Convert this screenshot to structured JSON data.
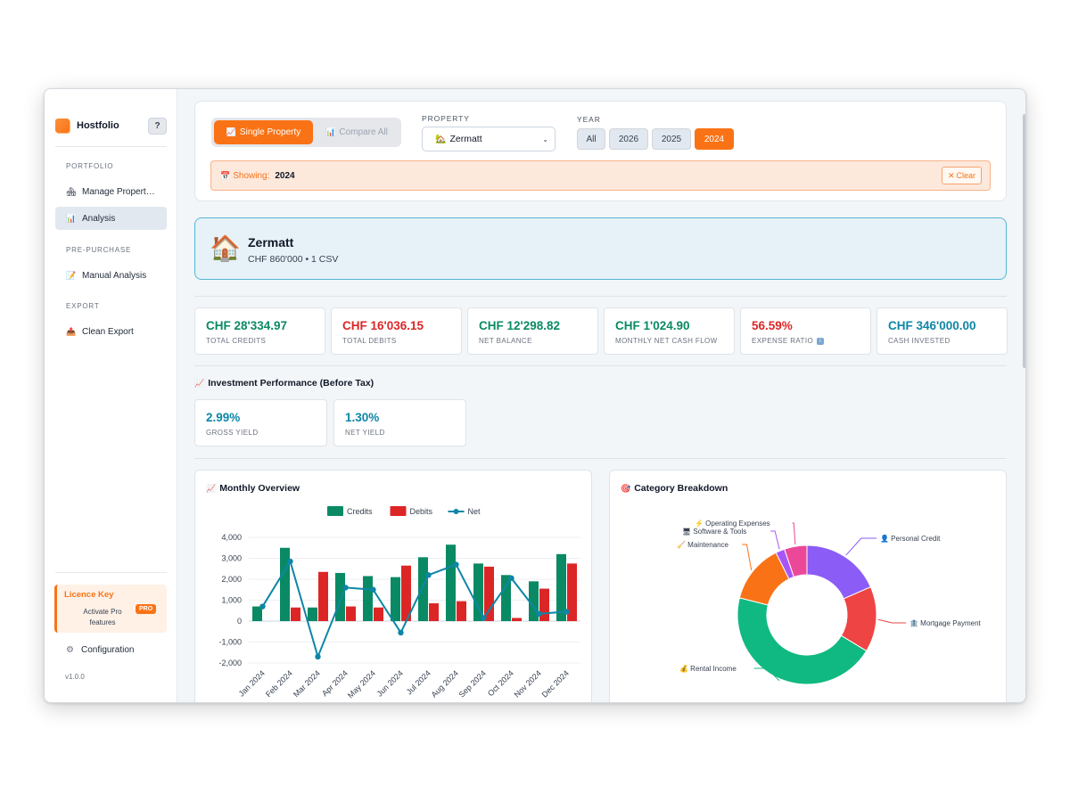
{
  "app": {
    "name": "Hostfolio",
    "help": "?"
  },
  "sidebar": {
    "sections": [
      {
        "label": "PORTFOLIO",
        "items": [
          {
            "label": "Manage Propert…",
            "icon": "house-icon"
          },
          {
            "label": "Analysis",
            "icon": "bar-chart-icon",
            "active": true
          }
        ]
      },
      {
        "label": "PRE-PURCHASE",
        "items": [
          {
            "label": "Manual Analysis",
            "icon": "memo-icon"
          }
        ]
      },
      {
        "label": "EXPORT",
        "items": [
          {
            "label": "Clean Export",
            "icon": "export-icon"
          }
        ]
      }
    ],
    "licence": {
      "title": "Licence Key",
      "desc": "Activate Pro features",
      "badge": "PRO"
    },
    "config_label": "Configuration",
    "version": "v1.0.0"
  },
  "toolbar": {
    "mode_single": "Single Property",
    "mode_compare": "Compare All",
    "property_label": "PROPERTY",
    "property_value": "Zermatt",
    "year_label": "YEAR",
    "years": [
      "All",
      "2026",
      "2025",
      "2024"
    ],
    "selected_year": "2024",
    "showing_label": "Showing:",
    "showing_value": "2024",
    "clear_label": "Clear"
  },
  "property": {
    "name": "Zermatt",
    "subtitle": "CHF 860'000 • 1 CSV"
  },
  "kpis": [
    {
      "value": "CHF 28'334.97",
      "label": "TOTAL CREDITS",
      "color": "#0a8a64"
    },
    {
      "value": "CHF 16'036.15",
      "label": "TOTAL DEBITS",
      "color": "#dc2626"
    },
    {
      "value": "CHF 12'298.82",
      "label": "NET BALANCE",
      "color": "#0a8a64"
    },
    {
      "value": "CHF 1'024.90",
      "label": "MONTHLY NET CASH FLOW",
      "color": "#0a8a64"
    },
    {
      "value": "56.59%",
      "label": "EXPENSE RATIO",
      "color": "#dc2626"
    },
    {
      "value": "CHF 346'000.00",
      "label": "CASH INVESTED",
      "color": "#0e86a6"
    }
  ],
  "investment": {
    "title": "Investment Performance (Before Tax)",
    "items": [
      {
        "value": "2.99%",
        "label": "GROSS YIELD"
      },
      {
        "value": "1.30%",
        "label": "NET YIELD"
      }
    ]
  },
  "monthly": {
    "title": "Monthly Overview"
  },
  "category": {
    "title": "Category Breakdown"
  },
  "colors": {
    "accent": "#f97316",
    "credits": "#0a8a64",
    "debits": "#dc2626",
    "net": "#0e86a6"
  },
  "chart_data": [
    {
      "type": "bar",
      "title": "Monthly Overview",
      "categories": [
        "Jan 2024",
        "Feb 2024",
        "Mar 2024",
        "Apr 2024",
        "May 2024",
        "Jun 2024",
        "Jul 2024",
        "Aug 2024",
        "Sep 2024",
        "Oct 2024",
        "Nov 2024",
        "Dec 2024"
      ],
      "series": [
        {
          "name": "Credits",
          "type": "bar",
          "color": "#0a8a64",
          "values": [
            700,
            3500,
            650,
            2300,
            2150,
            2100,
            3050,
            3650,
            2750,
            2200,
            1900,
            3200
          ]
        },
        {
          "name": "Debits",
          "type": "bar",
          "color": "#dc2626",
          "values": [
            0,
            650,
            2350,
            700,
            650,
            2650,
            850,
            950,
            2600,
            150,
            1550,
            2750
          ]
        },
        {
          "name": "Net",
          "type": "line",
          "color": "#0e86a6",
          "values": [
            700,
            2850,
            -1700,
            1600,
            1500,
            -550,
            2200,
            2700,
            150,
            2050,
            350,
            450
          ]
        }
      ],
      "ylim": [
        -2000,
        4000
      ],
      "yticks": [
        "4,000",
        "3,000",
        "2,000",
        "1,000",
        "0",
        "-1,000",
        "-2,000"
      ],
      "legend": "top",
      "grid": true
    },
    {
      "type": "pie",
      "title": "Category Breakdown",
      "labels": [
        "Personal Credit",
        "Mortgage Payment",
        "Rental Income",
        "Maintenance",
        "Software & Tools",
        "Operating Expenses"
      ],
      "values": [
        17.5,
        14.5,
        43,
        13,
        2,
        5
      ],
      "colors": [
        "#8b5cf6",
        "#ef4444",
        "#10b981",
        "#f97316",
        "#a855f7",
        "#ec4899"
      ],
      "icons": [
        "person-icon",
        "bank-icon",
        "money-bag-icon",
        "broom-icon",
        "computer-icon",
        "lightning-icon"
      ],
      "donut": true
    }
  ]
}
